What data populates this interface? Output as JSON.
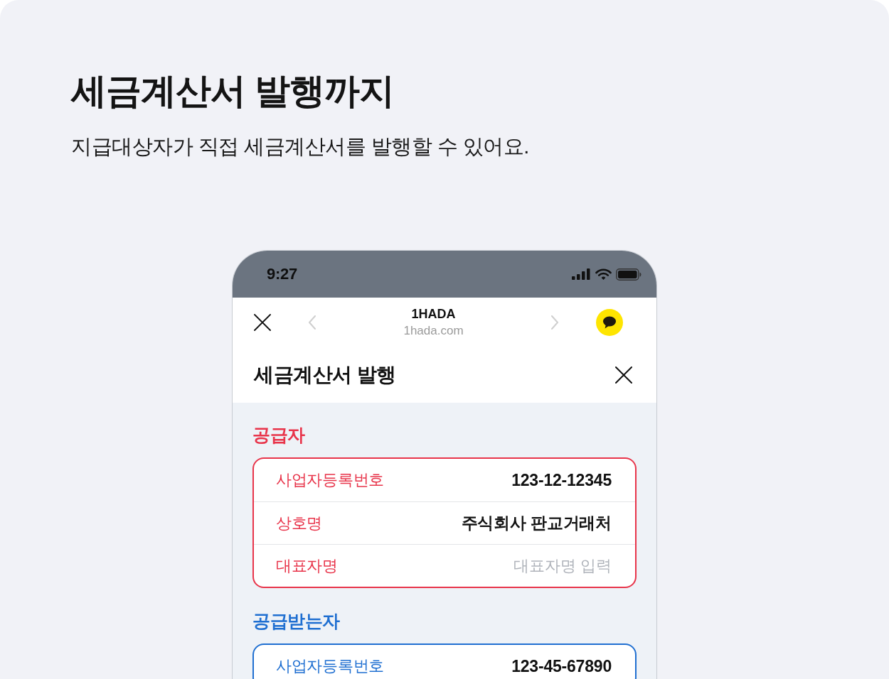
{
  "heading": {
    "title": "세금계산서 발행까지",
    "subtitle": "지급대상자가 직접 세금계산서를 발행할 수 있어요."
  },
  "phone": {
    "status_bar": {
      "time": "9:27"
    },
    "browser_bar": {
      "title": "1HADA",
      "url": "1hada.com",
      "back_disabled": true,
      "forward_disabled": true
    },
    "sheet": {
      "title": "세금계산서 발행",
      "sections": [
        {
          "title": "공급자",
          "color": "#e8344a",
          "fields": [
            {
              "kind": "value",
              "label": "사업자등록번호",
              "value": "123-12-12345"
            },
            {
              "kind": "value",
              "label": "상호명",
              "value": "주식회사 판교거래처"
            },
            {
              "kind": "input",
              "label": "대표자명",
              "placeholder": "대표자명 입력"
            }
          ]
        },
        {
          "title": "공급받는자",
          "color": "#1f6fd1",
          "fields": [
            {
              "kind": "value",
              "label": "사업자등록번호",
              "value": "123-45-67890"
            }
          ]
        }
      ]
    }
  }
}
